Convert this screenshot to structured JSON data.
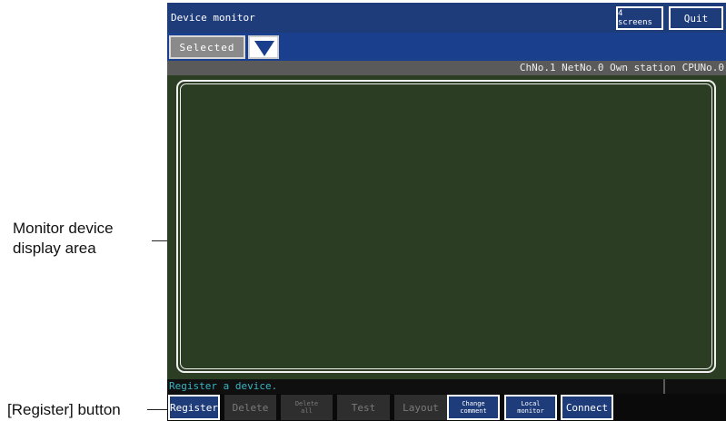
{
  "titlebar": {
    "title": "Device monitor",
    "screens_button": "4 screens",
    "quit_button": "Quit"
  },
  "toolbar": {
    "selected_label": "Selected",
    "dropdown_icon": "triangle-down-icon"
  },
  "status": {
    "text": "ChNo.1 NetNo.0 Own station CPUNo.0"
  },
  "message": {
    "text": "Register a device."
  },
  "bottom_buttons": {
    "register": "Register",
    "delete": "Delete",
    "delete_all_1": "Delete",
    "delete_all_2": "all",
    "test": "Test",
    "layout": "Layout",
    "change_comment_1": "Change",
    "change_comment_2": "comment",
    "local_monitor_1": "Local",
    "local_monitor_2": "monitor",
    "connect": "Connect"
  },
  "annotations": {
    "display_area_1": "Monitor device",
    "display_area_2": "display area",
    "register_button": "[Register] button"
  },
  "colors": {
    "title_bar": "#1f3c7a",
    "display_area": "#2b3d22",
    "message_text": "#39b5c4"
  }
}
